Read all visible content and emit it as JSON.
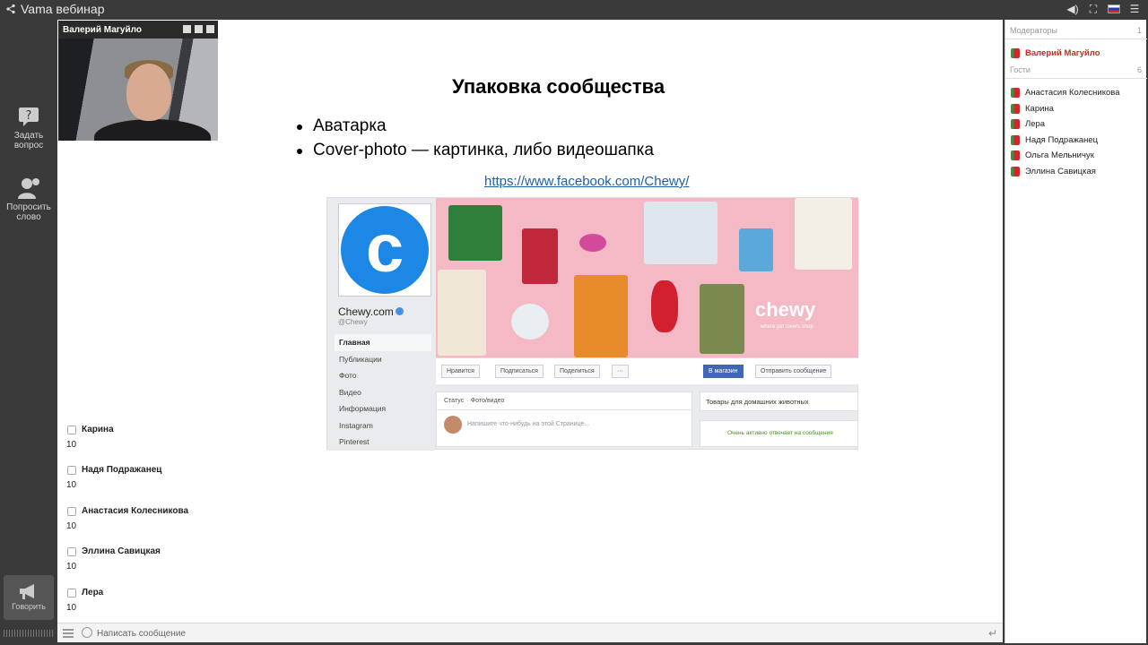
{
  "app": {
    "title": "Vama вебинар",
    "colors": {
      "accent_red": "#d0271d",
      "fb_blue": "#4267b2",
      "chewy_blue": "#1c87e5"
    }
  },
  "toolbar_icons": [
    "share-icon",
    "volume-icon",
    "fullscreen-icon",
    "russia-flag-icon",
    "menu-icon"
  ],
  "rail": {
    "ask_question": "Задать вопрос",
    "request_word": "Попросить слово",
    "speak": "Говорить"
  },
  "video": {
    "presenter": "Валерий Магуйло"
  },
  "slide": {
    "title": "Упаковка сообщества",
    "bullets": [
      "Аватарка",
      "Cover-photo — картинка, либо видеошапка"
    ],
    "link": "https://www.facebook.com/Chewy/"
  },
  "facebook": {
    "page_name": "Chewy.com",
    "handle": "@Chewy",
    "nav": [
      "Главная",
      "Публикации",
      "Фото",
      "Видео",
      "Информация",
      "Instagram",
      "Pinterest"
    ],
    "cover_brand": "chewy",
    "cover_tagline": "where pet lovers shop",
    "actions": [
      "Нравится",
      "Подписаться",
      "Поделиться",
      "···"
    ],
    "shop_button": "В магазин",
    "send_message": "Отправить сообщение",
    "post_tab_status": "Статус",
    "post_tab_photo": "Фото/видео",
    "post_placeholder": "Напишите что-нибудь на этой Странице...",
    "right_box1": "Товары для домашних животных",
    "right_box2": "Очень активно отвечает на сообщения"
  },
  "chat": [
    {
      "name": "Карина",
      "text": "10"
    },
    {
      "name": "Надя Подражанец",
      "text": "10"
    },
    {
      "name": "Анастасия Колесникова",
      "text": "10"
    },
    {
      "name": "Эллина Савицкая",
      "text": "10"
    },
    {
      "name": "Лера",
      "text": "10"
    }
  ],
  "input": {
    "placeholder": "Написать сообщение"
  },
  "panel": {
    "moderators_label": "Модераторы",
    "moderators_count": "1",
    "moderators": [
      "Валерий Магуйло"
    ],
    "guests_label": "Гости",
    "guests_count": "6",
    "guests": [
      "Анастасия Колесникова",
      "Карина",
      "Лера",
      "Надя Подражанец",
      "Ольга Мельничук",
      "Эллина Савицкая"
    ]
  }
}
